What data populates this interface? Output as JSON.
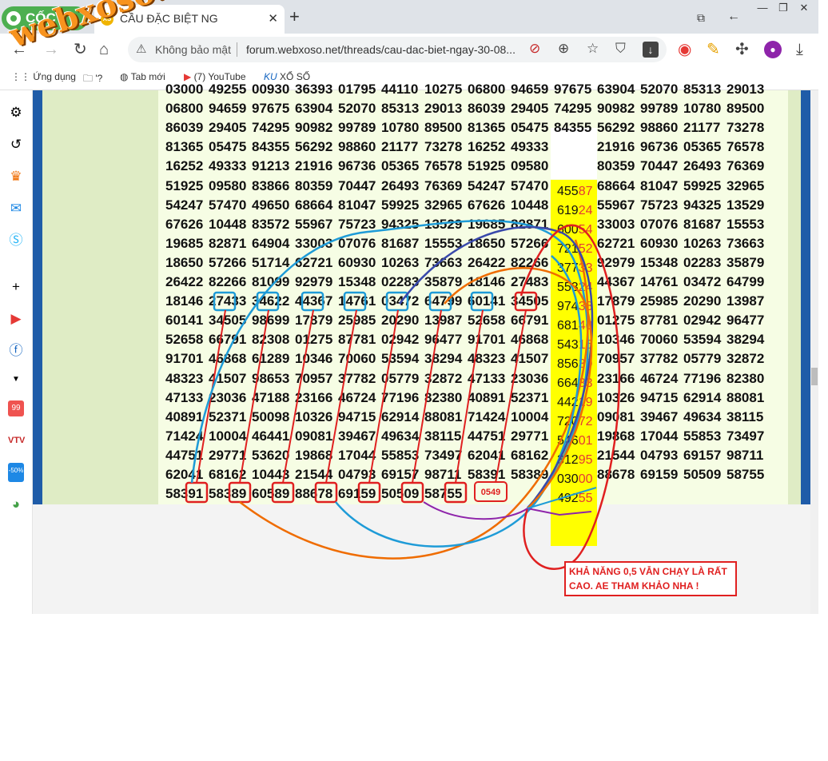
{
  "browser": {
    "brand": "CỐC CỐC",
    "tab_title": "CẦU ĐẶC BIỆT NG",
    "tab_close": "✕",
    "new_tab": "+",
    "security_label": "Không bảo mật",
    "url": "forum.webxoso.net/threads/cau-dac-biet-ngay-30-08..."
  },
  "bookmarks": [
    {
      "icon": "apps-icon",
      "label": "Ứng dụng"
    },
    {
      "icon": "folder-icon",
      "label": "'?"
    },
    {
      "icon": "globe-icon",
      "label": "Tab mới"
    },
    {
      "icon": "youtube-icon",
      "label": "(7) YouTube"
    },
    {
      "icon": "ku-icon",
      "label": "XỔ SỐ"
    }
  ],
  "sidebar_badges": {
    "shopee": "99",
    "tiki": "-50%"
  },
  "watermark": "webxoso.net",
  "grid_rows": [
    [
      "03000",
      "49255",
      "00930",
      "36393",
      "01795",
      "44110",
      "10275",
      "06800",
      "94659",
      "97675",
      "63904",
      "52070",
      "85313",
      "29013"
    ],
    [
      "06800",
      "94659",
      "97675",
      "63904",
      "52070",
      "85313",
      "29013",
      "86039",
      "29405",
      "74295",
      "90982",
      "99789",
      "10780",
      "89500"
    ],
    [
      "86039",
      "29405",
      "74295",
      "90982",
      "99789",
      "10780",
      "89500",
      "81365",
      "05475",
      "84355",
      "56292",
      "98860",
      "21177",
      "73278"
    ],
    [
      "81365",
      "05475",
      "84355",
      "56292",
      "98860",
      "21177",
      "73278",
      "16252",
      "49333",
      "",
      "21916",
      "96736",
      "05365",
      "76578"
    ],
    [
      "16252",
      "49333",
      "91213",
      "21916",
      "96736",
      "05365",
      "76578",
      "51925",
      "09580",
      "",
      "80359",
      "70447",
      "26493",
      "76369"
    ],
    [
      "51925",
      "09580",
      "83866",
      "80359",
      "70447",
      "26493",
      "76369",
      "54247",
      "57470",
      "",
      "68664",
      "81047",
      "59925",
      "32965"
    ],
    [
      "54247",
      "57470",
      "49650",
      "68664",
      "81047",
      "59925",
      "32965",
      "67626",
      "10448",
      "",
      "55967",
      "75723",
      "94325",
      "13529"
    ],
    [
      "67626",
      "10448",
      "83572",
      "55967",
      "75723",
      "94325",
      "13529",
      "19685",
      "82871",
      "",
      "33003",
      "07076",
      "81687",
      "15553"
    ],
    [
      "19685",
      "82871",
      "64904",
      "33003",
      "07076",
      "81687",
      "15553",
      "18650",
      "57266",
      "",
      "62721",
      "60930",
      "10263",
      "73663"
    ],
    [
      "18650",
      "57266",
      "51714",
      "62721",
      "60930",
      "10263",
      "73663",
      "26422",
      "82266",
      "",
      "92979",
      "15348",
      "02283",
      "35879"
    ],
    [
      "26422",
      "82266",
      "81099",
      "92979",
      "15348",
      "02283",
      "35879",
      "18146",
      "27483",
      "",
      "44367",
      "14761",
      "03472",
      "64799"
    ],
    [
      "18146",
      "27433",
      "34622",
      "44367",
      "14761",
      "03472",
      "64799",
      "60141",
      "34505",
      "",
      "17879",
      "25985",
      "20290",
      "13987"
    ],
    [
      "60141",
      "34505",
      "98699",
      "17879",
      "25985",
      "20290",
      "13987",
      "52658",
      "66791",
      "",
      "01275",
      "87781",
      "02942",
      "96477"
    ],
    [
      "52658",
      "66791",
      "82308",
      "01275",
      "87781",
      "02942",
      "96477",
      "91701",
      "46868",
      "",
      "10346",
      "70060",
      "53594",
      "38294"
    ],
    [
      "91701",
      "46868",
      "61289",
      "10346",
      "70060",
      "53594",
      "38294",
      "48323",
      "41507",
      "",
      "70957",
      "37782",
      "05779",
      "32872"
    ],
    [
      "48323",
      "41507",
      "98653",
      "70957",
      "37782",
      "05779",
      "32872",
      "47133",
      "23036",
      "",
      "23166",
      "46724",
      "77196",
      "82380"
    ],
    [
      "47133",
      "23036",
      "47188",
      "23166",
      "46724",
      "77196",
      "82380",
      "40891",
      "52371",
      "",
      "10326",
      "94715",
      "62914",
      "88081"
    ],
    [
      "40891",
      "52371",
      "50098",
      "10326",
      "94715",
      "62914",
      "88081",
      "71424",
      "10004",
      "",
      "09081",
      "39467",
      "49634",
      "38115"
    ],
    [
      "71424",
      "10004",
      "46441",
      "09081",
      "39467",
      "49634",
      "38115",
      "44751",
      "29771",
      "",
      "19868",
      "17044",
      "55853",
      "73497"
    ],
    [
      "44751",
      "29771",
      "53620",
      "19868",
      "17044",
      "55853",
      "73497",
      "62041",
      "68162",
      "",
      "21544",
      "04793",
      "69157",
      "98711"
    ],
    [
      "62041",
      "68162",
      "10443",
      "21544",
      "04793",
      "69157",
      "98711",
      "58391",
      "58389",
      "",
      "88678",
      "69159",
      "50509",
      "58755"
    ],
    [
      "58391",
      "58389",
      "60589",
      "88678",
      "69159",
      "50509",
      "58755",
      "",
      "",
      "",
      "",
      "",
      "",
      ""
    ]
  ],
  "yellow_column": [
    "45587",
    "61924",
    "60054",
    "72152",
    "37733",
    "55324",
    "97438",
    "68140",
    "54315",
    "85639",
    "66433",
    "44219",
    "72072",
    "54601",
    "31295",
    "03000",
    "49255"
  ],
  "circled_bottom": [
    "91",
    "89",
    "89",
    "78",
    "59",
    "09",
    "55",
    "0549"
  ],
  "circled_top": [
    "74",
    "46",
    "43",
    "47",
    "34",
    "64",
    "60",
    "34"
  ],
  "note": "KHẢ NĂNG 0,5 VẪN CHẠY LÀ RẤT CAO. AE THAM KHẢO NHA !"
}
